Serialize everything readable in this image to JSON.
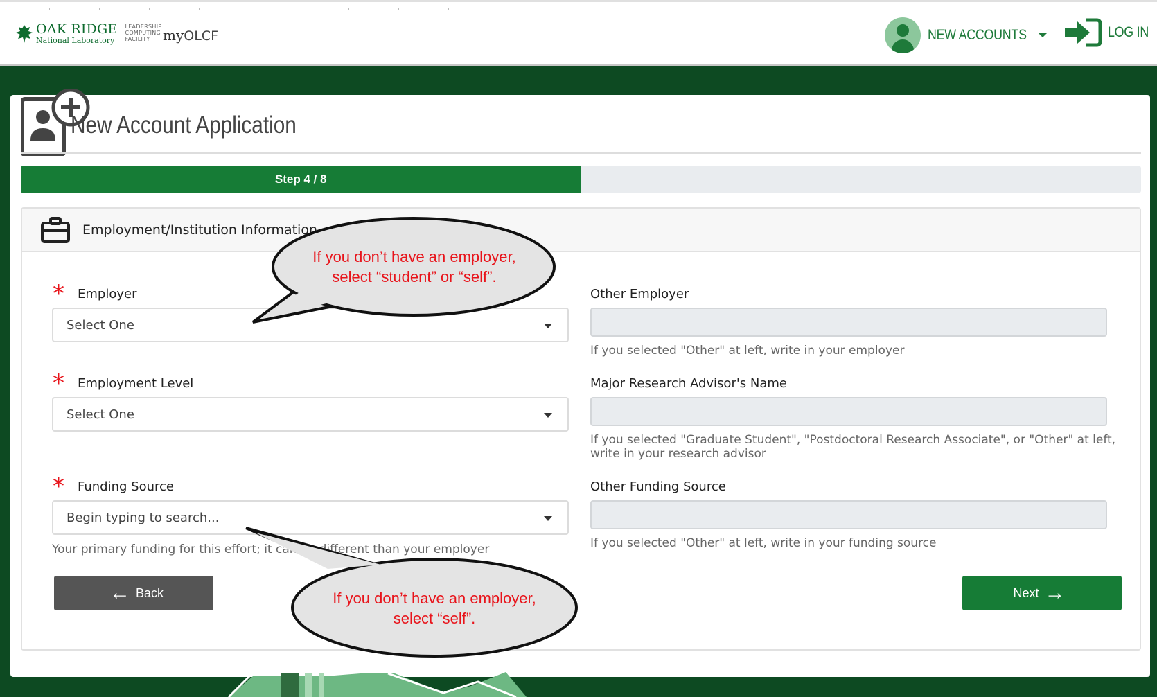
{
  "header": {
    "org_line1": "OAK RIDGE",
    "org_line2": "National Laboratory",
    "facility_lines": [
      "LEADERSHIP",
      "COMPUTING",
      "FACILITY"
    ],
    "app_prefix": "my",
    "app_name": "OLCF",
    "nav": {
      "new_accounts": "NEW ACCOUNTS",
      "login": "LOG IN"
    }
  },
  "page": {
    "title": "New Account Application",
    "progress_label": "Step 4 / 8",
    "progress_fraction": 0.5
  },
  "section": {
    "title": "Employment/Institution Information",
    "fields": {
      "employer": {
        "label": "Employer",
        "value": "Select One"
      },
      "employment_level": {
        "label": "Employment Level",
        "value": "Select One"
      },
      "funding_source": {
        "label": "Funding Source",
        "placeholder": "Begin typing to search...",
        "help": "Your primary funding for this effort; it can be different than your employer"
      },
      "other_employer": {
        "label": "Other Employer",
        "help": "If you selected \"Other\" at left, write in your employer"
      },
      "research_advisor": {
        "label": "Major Research Advisor's Name",
        "help_line1": "If you selected \"Graduate Student\", \"Postdoctoral Research Associate\", or \"Other\" at left,",
        "help_line2": "write in your research advisor"
      },
      "other_funding": {
        "label": "Other Funding Source",
        "help": "If you selected \"Other\" at left, write in your funding source"
      }
    },
    "buttons": {
      "back": "Back",
      "next": "Next"
    }
  },
  "callouts": {
    "top_line1": "If you don’t have an employer,",
    "top_line2": "select “student” or “self”.",
    "bottom_line1": "If you don’t have an employer,",
    "bottom_line2": "select “self”."
  },
  "colors": {
    "brand_green": "#167c36",
    "background_green": "#0d4a22",
    "required_star": "#e8141b",
    "callout_text": "#e8141b",
    "back_button": "#555555"
  },
  "icons": {
    "logo": "oak-leaf-icon",
    "nav_user": "user-circle-icon",
    "nav_login": "sign-in-icon",
    "header": "add-user-card-icon",
    "section": "briefcase-icon",
    "back": "arrow-left-icon",
    "next": "arrow-right-icon",
    "dropdown": "caret-down-icon"
  }
}
